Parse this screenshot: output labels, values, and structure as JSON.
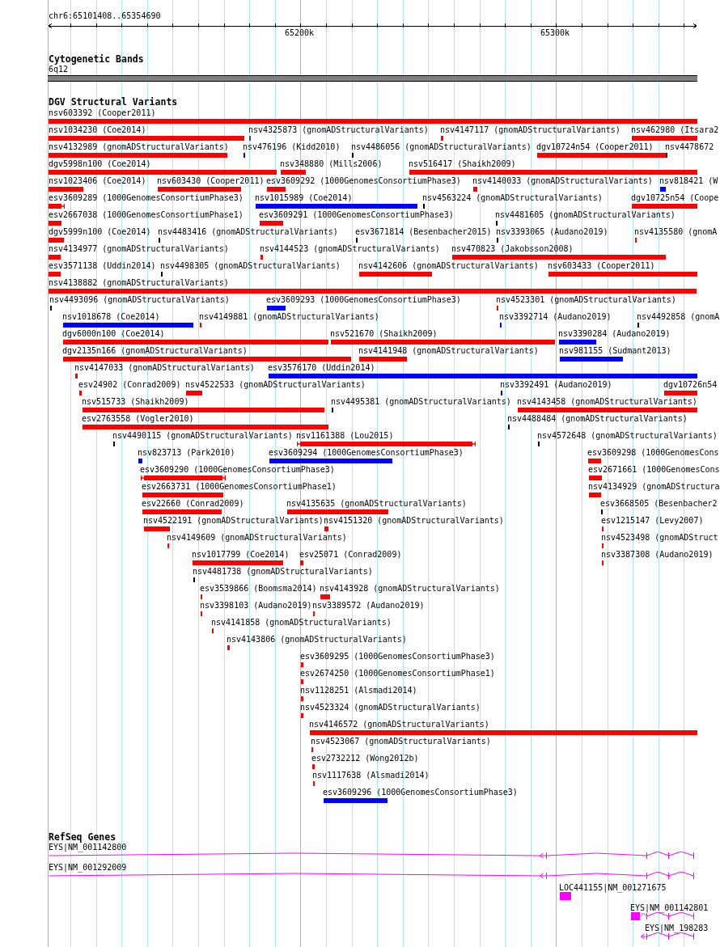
{
  "ruler": {
    "location": "chr6:65101408..65354690",
    "ticks": [
      "65200k",
      "65300k"
    ]
  },
  "tracks": [
    {
      "kind": "bands",
      "title": "Cytogenetic Bands",
      "features": [
        {
          "label": "6q12"
        }
      ]
    },
    {
      "kind": "variants",
      "title": "DGV Structural Variants",
      "rows": [
        {
          "features": [
            {
              "label": "nsv603392 (Cooper2011)",
              "color": "#ff0000"
            }
          ]
        },
        {
          "features": [
            {
              "label": "nsv1034230 (Coe2014)",
              "color": "#ff0000"
            },
            {
              "label": "nsv4325873 (gnomADStructuralVariants)",
              "color": "#663399"
            },
            {
              "label": "nsv4147117 (gnomADStructuralVariants)",
              "color": "#ff0000"
            },
            {
              "label": "nsv462980 (Itsara2",
              "color": "#ff0000"
            }
          ]
        },
        {
          "features": [
            {
              "label": "nsv4132989 (gnomADStructuralVariants)",
              "color": "#ff0000"
            },
            {
              "label": "nsv476196 (Kidd2010)",
              "color": "#0000ff"
            },
            {
              "label": "nsv4486056 (gnomADStructuralVariants)",
              "color": "#000000"
            },
            {
              "label": "dgv10724n54 (Cooper2011)",
              "color": "#ff0000"
            },
            {
              "label": "nsv4478672",
              "color": "#000000"
            }
          ]
        },
        {
          "features": [
            {
              "label": "dgv5998n100 (Coe2014)",
              "color": "#ff0000"
            },
            {
              "label": "nsv348880 (Mills2006)",
              "color": "#ff0000"
            },
            {
              "label": "nsv516417 (Shaikh2009)",
              "color": "#ff0000"
            }
          ]
        },
        {
          "features": [
            {
              "label": "nsv1023406 (Coe2014)",
              "color": "#ff0000"
            },
            {
              "label": "nsv603430 (Cooper2011)",
              "color": "#ff0000"
            },
            {
              "label": "esv3609292 (1000GenomesConsortiumPhase3)",
              "color": "#ff0000"
            },
            {
              "label": "nsv4140033 (gnomADStructuralVariants)",
              "color": "#ff0000"
            },
            {
              "label": "nsv818421 (W",
              "color": "#0000ff"
            }
          ]
        },
        {
          "features": [
            {
              "label": "esv3609289 (1000GenomesConsortiumPhase3)",
              "color": "#ff0000"
            },
            {
              "label": "nsv1015989 (Coe2014)",
              "color": "#0000ff"
            },
            {
              "label": "nsv4563224 (gnomADStructuralVariants)",
              "color": "#000000"
            },
            {
              "label": "dgv10725n54 (Coope",
              "color": "#ff0000"
            }
          ]
        },
        {
          "features": [
            {
              "label": "esv2667038 (1000GenomesConsortiumPhase1)",
              "color": "#ff0000"
            },
            {
              "label": "esv3609291 (1000GenomesConsortiumPhase3)",
              "color": "#ff0000"
            },
            {
              "label": "nsv4481605 (gnomADStructuralVariants)",
              "color": "#000000"
            }
          ]
        },
        {
          "features": [
            {
              "label": "dgv5999n100 (Coe2014)",
              "color": "#ff0000"
            },
            {
              "label": "nsv4483416 (gnomADStructuralVariants)",
              "color": "#000000"
            },
            {
              "label": "esv3671814 (Besenbacher2015)",
              "color": "#000000"
            },
            {
              "label": "nsv3393065 (Audano2019)",
              "color": "#000000"
            },
            {
              "label": "nsv4135580 (gnomA",
              "color": "#ff0000"
            }
          ]
        },
        {
          "features": [
            {
              "label": "nsv4134977 (gnomADStructuralVariants)",
              "color": "#ff0000"
            },
            {
              "label": "nsv4144523 (gnomADStructuralVariants)",
              "color": "#ff0000"
            },
            {
              "label": "nsv470823 (Jakobsson2008)",
              "color": "#ff0000"
            }
          ]
        },
        {
          "features": [
            {
              "label": "esv3571138 (Uddin2014)",
              "color": "#ff0000"
            },
            {
              "label": "nsv4498305 (gnomADStructuralVariants)",
              "color": "#000000"
            },
            {
              "label": "nsv4142606 (gnomADStructuralVariants)",
              "color": "#ff0000"
            },
            {
              "label": "nsv603433 (Cooper2011)",
              "color": "#ff0000"
            }
          ]
        },
        {
          "features": [
            {
              "label": "nsv4138882 (gnomADStructuralVariants)",
              "color": "#ff0000"
            }
          ]
        },
        {
          "features": [
            {
              "label": "nsv4493096 (gnomADStructuralVariants)",
              "color": "#000000"
            },
            {
              "label": "esv3609293 (1000GenomesConsortiumPhase3)",
              "color": "#0000ff"
            },
            {
              "label": "nsv4523301 (gnomADStructuralVariants)",
              "color": "#ff0000"
            }
          ]
        },
        {
          "features": [
            {
              "label": "nsv1018678 (Coe2014)",
              "color": "#0000ff"
            },
            {
              "label": "nsv4149881 (gnomADStructuralVariants)",
              "color": "#ff0000"
            },
            {
              "label": "nsv3392714 (Audano2019)",
              "color": "#0000ff"
            },
            {
              "label": "nsv4492858 (gnomA",
              "color": "#000000"
            }
          ]
        },
        {
          "features": [
            {
              "label": "dgv6000n100 (Coe2014)",
              "color": "#ff0000"
            },
            {
              "label": "nsv521670 (Shaikh2009)",
              "color": "#ff0000"
            },
            {
              "label": "nsv3390284 (Audano2019)",
              "color": "#0000ff"
            }
          ]
        },
        {
          "features": [
            {
              "label": "dgv2135n166 (gnomADStructuralVariants)",
              "color": "#ff0000"
            },
            {
              "label": "nsv4141948 (gnomADStructuralVariants)",
              "color": "#ff0000"
            },
            {
              "label": "nsv981155 (Sudmant2013)",
              "color": "#0000ff"
            }
          ]
        },
        {
          "features": [
            {
              "label": "nsv4147033 (gnomADStructuralVariants)",
              "color": "#ff0000"
            },
            {
              "label": "esv3576170 (Uddin2014)",
              "color": "#0000ff"
            }
          ]
        },
        {
          "features": [
            {
              "label": "esv24902 (Conrad2009)",
              "color": "#ff0000"
            },
            {
              "label": "nsv4522533 (gnomADStructuralVariants)",
              "color": "#ff0000"
            },
            {
              "label": "nsv3392491 (Audano2019)",
              "color": "#0000ff"
            },
            {
              "label": "dgv10726n54",
              "color": "#ff0000"
            }
          ]
        },
        {
          "features": [
            {
              "label": "nsv515733 (Shaikh2009)",
              "color": "#ff0000"
            },
            {
              "label": "nsv4495381 (gnomADStructuralVariants)",
              "color": "#000000"
            },
            {
              "label": "nsv4143458 (gnomADStructuralVariants)",
              "color": "#ff0000"
            }
          ]
        },
        {
          "features": [
            {
              "label": "esv2763558 (Vogler2010)",
              "color": "#ff0000"
            },
            {
              "label": "nsv4488484 (gnomADStructuralVariants)",
              "color": "#000000"
            }
          ]
        },
        {
          "features": [
            {
              "label": "nsv4490115 (gnomADStructuralVariants)",
              "color": "#000000"
            },
            {
              "label": "nsv1161388 (Lou2015)",
              "color": "#ff0000"
            },
            {
              "label": "nsv4572648 (gnomADStructuralVariants)",
              "color": "#000000"
            }
          ]
        },
        {
          "features": [
            {
              "label": "nsv823713 (Park2010)",
              "color": "#0000ff"
            },
            {
              "label": "esv3609294 (1000GenomesConsortiumPhase3)",
              "color": "#0000ff"
            },
            {
              "label": "esv3609298 (1000GenomesCons",
              "color": "#ff0000"
            }
          ]
        },
        {
          "features": [
            {
              "label": "esv3609290 (1000GenomesConsortiumPhase3)",
              "color": "#ff0000"
            },
            {
              "label": "esv2671661 (1000GenomesCons",
              "color": "#ff0000"
            }
          ]
        },
        {
          "features": [
            {
              "label": "esv2663731 (1000GenomesConsortiumPhase1)",
              "color": "#ff0000"
            },
            {
              "label": "nsv4134929 (gnomADStructura",
              "color": "#ff0000"
            }
          ]
        },
        {
          "features": [
            {
              "label": "esv22660 (Conrad2009)",
              "color": "#ff0000"
            },
            {
              "label": "nsv4135635 (gnomADStructuralVariants)",
              "color": "#ff0000"
            },
            {
              "label": "esv3668505 (Besenbacher2",
              "color": "#000000"
            }
          ]
        },
        {
          "features": [
            {
              "label": "nsv4522191 (gnomADStructuralVariants)",
              "color": "#ff0000"
            },
            {
              "label": "nsv4151320 (gnomADStructuralVariants)",
              "color": "#ff0000"
            },
            {
              "label": "esv1215147 (Levy2007)",
              "color": "#ff0000"
            }
          ]
        },
        {
          "features": [
            {
              "label": "nsv4149609 (gnomADStructuralVariants)",
              "color": "#ff0000"
            },
            {
              "label": "nsv4523498 (gnomADStruct",
              "color": "#ff0000"
            }
          ]
        },
        {
          "features": [
            {
              "label": "nsv1017799 (Coe2014)",
              "color": "#ff0000"
            },
            {
              "label": "esv25071 (Conrad2009)",
              "color": "#ff0000"
            },
            {
              "label": "nsv3387308 (Audano2019)",
              "color": "#ff0000"
            }
          ]
        },
        {
          "features": [
            {
              "label": "nsv4481738 (gnomADStructuralVariants)",
              "color": "#000000"
            }
          ]
        },
        {
          "features": [
            {
              "label": "esv3539866 (Boomsma2014)",
              "color": "#ff0000"
            },
            {
              "label": "nsv4143928 (gnomADStructuralVariants)",
              "color": "#ff0000"
            }
          ]
        },
        {
          "features": [
            {
              "label": "nsv3398103 (Audano2019)",
              "color": "#ff0000"
            },
            {
              "label": "nsv3389572 (Audano2019)",
              "color": "#ff0000"
            }
          ]
        },
        {
          "features": [
            {
              "label": "nsv4141858 (gnomADStructuralVariants)",
              "color": "#ff0000"
            }
          ]
        },
        {
          "features": [
            {
              "label": "nsv4143806 (gnomADStructuralVariants)",
              "color": "#ff0000"
            }
          ]
        },
        {
          "features": [
            {
              "label": "esv3609295 (1000GenomesConsortiumPhase3)",
              "color": "#ff0000"
            }
          ]
        },
        {
          "features": [
            {
              "label": "esv2674250 (1000GenomesConsortiumPhase1)",
              "color": "#ff0000"
            }
          ]
        },
        {
          "features": [
            {
              "label": "nsv1128251 (Alsmadi2014)",
              "color": "#ff0000"
            }
          ]
        },
        {
          "features": [
            {
              "label": "nsv4523324 (gnomADStructuralVariants)",
              "color": "#ff0000"
            }
          ]
        },
        {
          "features": [
            {
              "label": "nsv4146572 (gnomADStructuralVariants)",
              "color": "#ff0000"
            }
          ]
        },
        {
          "features": [
            {
              "label": "nsv4523067 (gnomADStructuralVariants)",
              "color": "#ff0000"
            }
          ]
        },
        {
          "features": [
            {
              "label": "esv2732212 (Wong2012b)",
              "color": "#ff0000"
            }
          ]
        },
        {
          "features": [
            {
              "label": "nsv1117638 (Alsmadi2014)",
              "color": "#ff0000"
            }
          ]
        },
        {
          "features": [
            {
              "label": "esv3609296 (1000GenomesConsortiumPhase3)",
              "color": "#0000ff"
            }
          ]
        }
      ]
    },
    {
      "kind": "genes",
      "title": "RefSeq Genes",
      "features": [
        {
          "label": "EYS|NM_001142800"
        },
        {
          "label": "EYS|NM_001292009"
        },
        {
          "label": "LOC441155|NM_001271675"
        },
        {
          "label": "EYS|NM_001142801"
        },
        {
          "label": "EYS|NM_198283"
        }
      ]
    }
  ]
}
